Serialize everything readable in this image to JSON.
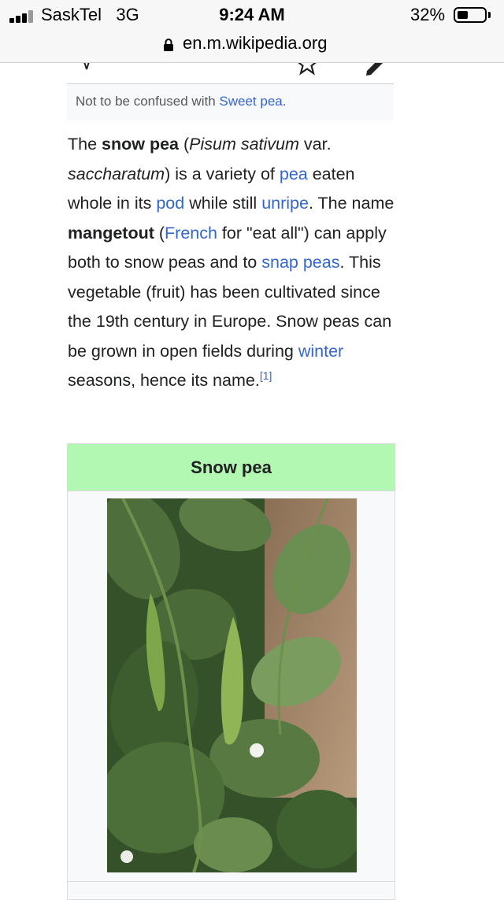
{
  "status_bar": {
    "carrier": "SaskTel",
    "network": "3G",
    "time": "9:24 AM",
    "battery_percent": "32%",
    "battery_level": 0.32
  },
  "url_bar": {
    "url": "en.m.wikipedia.org"
  },
  "hatnote": {
    "prefix": "Not to be confused with ",
    "link": "Sweet pea",
    "suffix": "."
  },
  "article": {
    "p1": {
      "t1": "The ",
      "b1": "snow pea",
      "t2": " (",
      "i1": "Pisum sativum",
      "t3": " var. ",
      "i2": "saccharatum",
      "t4": ") is a variety of ",
      "l_pea": "pea",
      "t5": " eaten whole in its ",
      "l_pod": "pod",
      "t6": " while still ",
      "l_unripe": "unripe",
      "t7": ". The name ",
      "b2": "mangetout",
      "t8": " (",
      "l_french": "French",
      "t9": " for \"eat all\") can apply both to snow peas and to ",
      "l_snap": "snap peas",
      "t10": ". This vegetable (fruit) has been cultivated since the 19th century in Europe. Snow peas can be grown in open fields during ",
      "l_winter": "winter",
      "t11": " seasons, hence its name.",
      "ref": "[1]"
    }
  },
  "infobox": {
    "title": "Snow pea",
    "header_color": "#b2f7b2"
  },
  "icons": {
    "lock": "lock-icon",
    "font_size": "text-size-icon",
    "watch": "star-icon",
    "edit": "pencil-icon"
  }
}
